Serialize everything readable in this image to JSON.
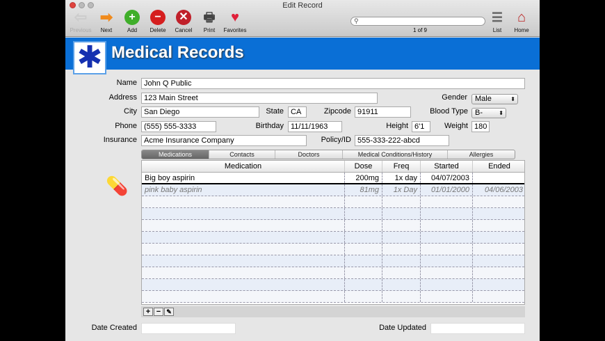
{
  "window": {
    "title": "Edit Record"
  },
  "toolbar": {
    "previous": "Previous",
    "next": "Next",
    "add": "Add",
    "delete": "Delete",
    "cancel": "Cancel",
    "print": "Print",
    "favorites": "Favorites",
    "list": "List",
    "home": "Home",
    "search_value": "",
    "record_count": "1 of 9"
  },
  "banner": {
    "title": "Medical Records"
  },
  "form": {
    "name_label": "Name",
    "name": "John Q Public",
    "address_label": "Address",
    "address": "123 Main Street",
    "gender_label": "Gender",
    "gender": "Male",
    "city_label": "City",
    "city": "San Diego",
    "state_label": "State",
    "state": "CA",
    "zip_label": "Zipcode",
    "zip": "91911",
    "blood_label": "Blood Type",
    "blood": "B-",
    "phone_label": "Phone",
    "phone": "(555) 555-3333",
    "birthday_label": "Birthday",
    "birthday": "11/11/1963",
    "height_label": "Height",
    "height": "6'1",
    "weight_label": "Weight",
    "weight": "180",
    "insurance_label": "Insurance",
    "insurance": "Acme Insurance Company",
    "policy_label": "Policy/ID",
    "policy": "555-333-222-abcd",
    "date_created_label": "Date Created",
    "date_created": "",
    "date_updated_label": "Date Updated",
    "date_updated": ""
  },
  "tabs": [
    "Medications",
    "Contacts",
    "Doctors",
    "Medical Conditions/History",
    "Allergies"
  ],
  "table": {
    "headers": [
      "Medication",
      "Dose",
      "Freq",
      "Started",
      "Ended"
    ],
    "rows": [
      [
        "Big boy aspirin",
        "200mg",
        "1x day",
        "04/07/2003",
        ""
      ],
      [
        "pink baby aspirin",
        "81mg",
        "1x Day",
        "01/01/2000",
        "04/06/2003"
      ]
    ]
  }
}
